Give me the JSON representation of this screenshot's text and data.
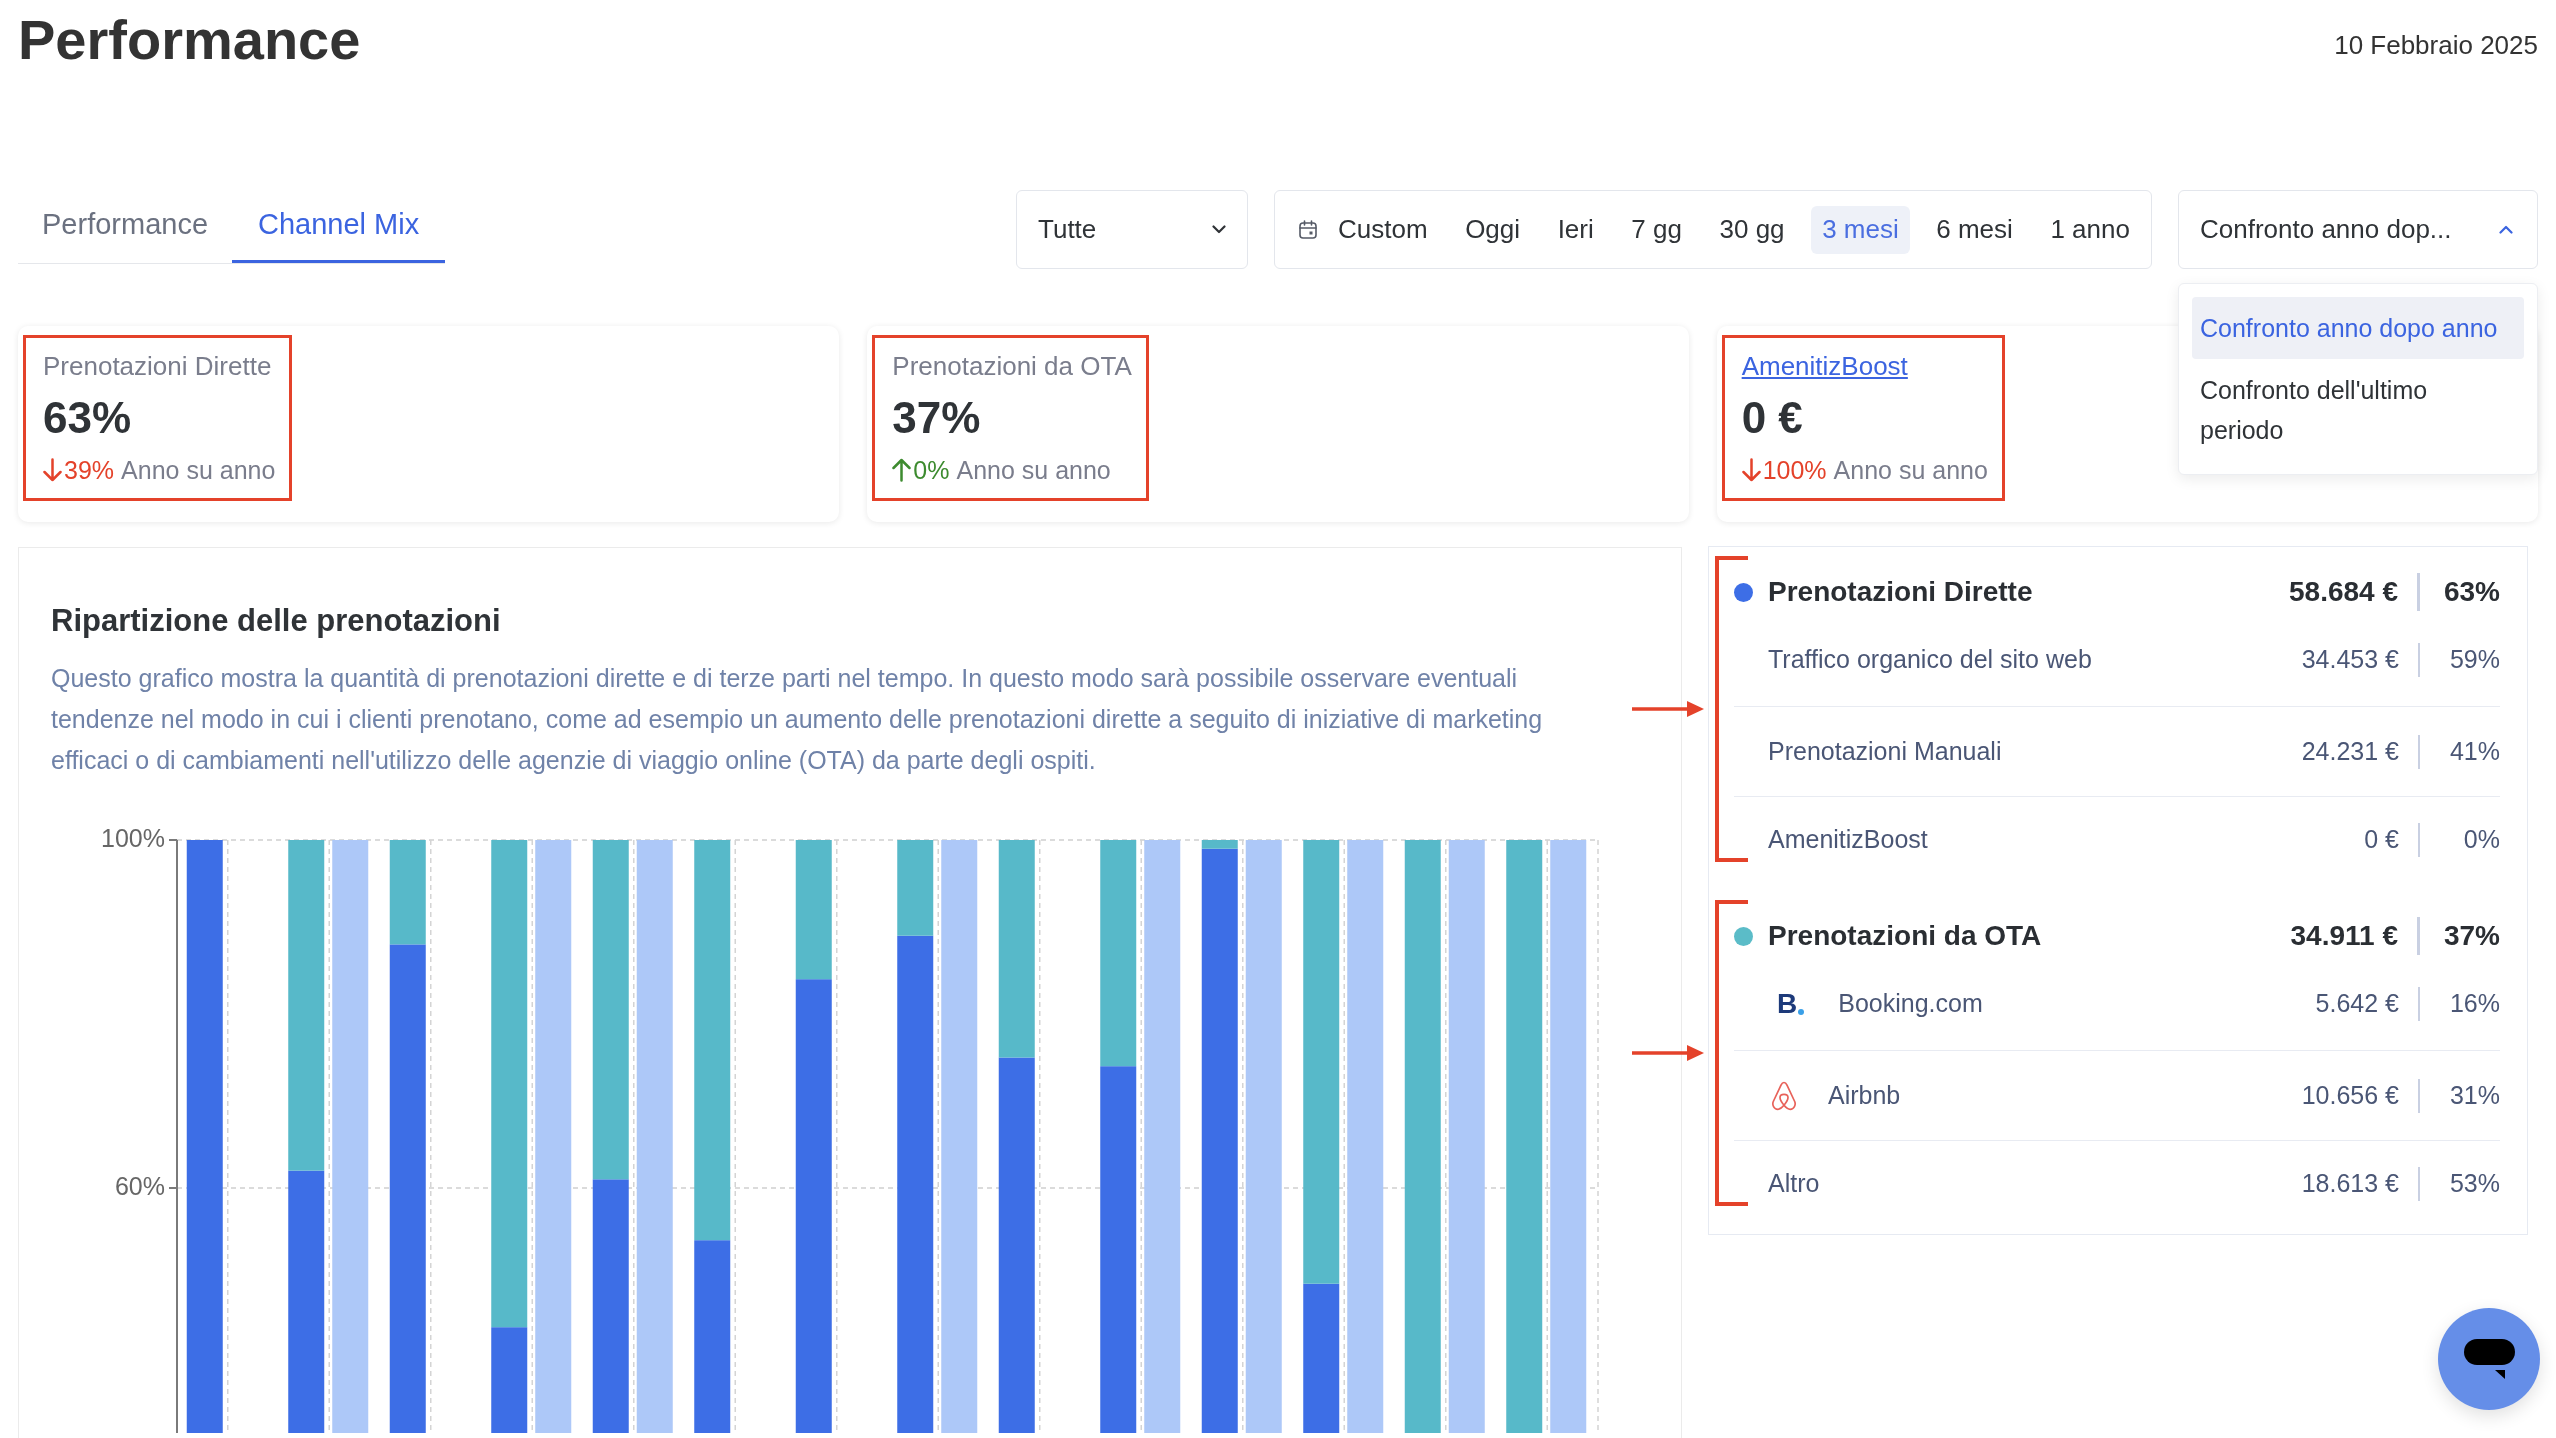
{
  "page": {
    "title": "Performance",
    "date": "10 Febbraio 2025"
  },
  "tabs": [
    {
      "label": "Performance",
      "selected": false
    },
    {
      "label": "Channel Mix",
      "selected": true
    }
  ],
  "filters": {
    "channel": {
      "value": "Tutte",
      "expanded": false
    },
    "date_range": {
      "presets": [
        {
          "label": "Custom",
          "selected": false
        },
        {
          "label": "Oggi",
          "selected": false
        },
        {
          "label": "Ieri",
          "selected": false
        },
        {
          "label": "7 gg",
          "selected": false
        },
        {
          "label": "30 gg",
          "selected": false
        },
        {
          "label": "3 mesi",
          "selected": true
        },
        {
          "label": "6 mesi",
          "selected": false
        },
        {
          "label": "1 anno",
          "selected": false
        }
      ]
    },
    "comparison": {
      "value": "Confronto anno dop...",
      "expanded": true,
      "options": [
        {
          "label": "Confronto anno dopo anno",
          "selected": true
        },
        {
          "label": "Confronto dell'ultimo periodo",
          "selected": false
        }
      ]
    }
  },
  "kpis": [
    {
      "kind": "text",
      "label": "Prenotazioni Dirette",
      "value": "63%",
      "decline": true,
      "change": "39%",
      "caption": "Anno su anno",
      "highlighted": true
    },
    {
      "kind": "text",
      "label": "Prenotazioni da OTA",
      "value": "37%",
      "decline": false,
      "change": "0%",
      "caption": "Anno su anno",
      "highlighted": true
    },
    {
      "kind": "link",
      "label": "AmenitizBoost",
      "value": "0 €",
      "decline": true,
      "change": "100%",
      "caption": "Anno su anno",
      "highlighted": true
    }
  ],
  "booking_breakdown": {
    "title": "Ripartizione delle prenotazioni",
    "description": "Questo grafico mostra la quantità di prenotazioni dirette e di terze parti nel tempo. In questo modo sarà possibile osservare eventuali tendenze nel modo in cui i clienti prenotano, come ad esempio un aumento delle prenotazioni dirette a seguito di iniziative di marketing efficaci o di cambiamenti nell'utilizzo delle agenzie di viaggio online (OTA) da parte degli ospiti.",
    "chart_data": {
      "type": "bar",
      "stacked": true,
      "grid": true,
      "ylim": [
        0,
        100
      ],
      "yticks": [
        {
          "value": 100,
          "label": "100%"
        },
        {
          "value": 60,
          "label": "60%"
        }
      ],
      "series": [
        {
          "color": "#3d6ee6",
          "values": [
            100,
            null,
            62,
            null,
            88,
            null,
            44,
            null,
            61,
            null,
            54,
            null,
            84,
            null,
            89,
            null,
            75,
            null,
            74,
            null,
            99,
            null,
            49,
            null,
            null,
            null,
            null,
            null
          ]
        },
        {
          "color": "#57b9c9",
          "values": [
            null,
            null,
            38,
            null,
            12,
            null,
            56,
            null,
            39,
            null,
            46,
            null,
            16,
            null,
            11,
            null,
            25,
            null,
            26,
            null,
            1,
            null,
            51,
            null,
            100,
            null,
            100,
            null
          ]
        },
        {
          "color": "#adc8f8",
          "values": [
            null,
            null,
            null,
            100,
            null,
            null,
            null,
            100,
            null,
            100,
            null,
            null,
            null,
            null,
            null,
            100,
            null,
            null,
            null,
            100,
            null,
            100,
            null,
            100,
            null,
            100,
            null,
            100
          ]
        }
      ]
    }
  },
  "channel_breakdown": {
    "groups": [
      {
        "title": "Prenotazioni Dirette",
        "color": "#3d6ee6",
        "value": "58.684 €",
        "share": "63%",
        "highlighted": true,
        "items": [
          {
            "kind": "plain",
            "label": "Traffico organico del sito web",
            "value": "34.453 €",
            "share": "59%"
          },
          {
            "kind": "plain",
            "label": "Prenotazioni Manuali",
            "value": "24.231 €",
            "share": "41%"
          },
          {
            "kind": "plain",
            "label": "AmenitizBoost",
            "value": "0 €",
            "share": "0%"
          }
        ]
      },
      {
        "title": "Prenotazioni da OTA",
        "color": "#5bbcc8",
        "value": "34.911 €",
        "share": "37%",
        "highlighted": true,
        "items": [
          {
            "kind": "lettermark",
            "logo_text": "B",
            "label": "Booking.com",
            "value": "5.642 €",
            "share": "16%"
          },
          {
            "kind": "symbol",
            "label": "Airbnb",
            "value": "10.656 €",
            "share": "31%"
          },
          {
            "kind": "plain",
            "label": "Altro",
            "value": "18.613 €",
            "share": "53%"
          }
        ]
      }
    ]
  }
}
